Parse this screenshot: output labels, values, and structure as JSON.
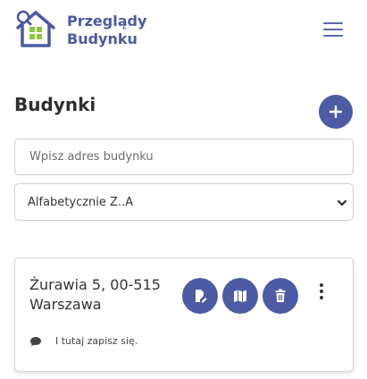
{
  "app": {
    "brand_line1": "Przeglądy",
    "brand_line2": "Budynku",
    "brand_color": "#4a5aa4",
    "logo_roof_color": "#4a5aa4",
    "logo_window_color": "#8cc63f"
  },
  "header": {
    "menu_icon": "hamburger-menu-icon"
  },
  "main": {
    "title": "Budynki",
    "add_icon": "plus-icon",
    "search": {
      "placeholder": "Wpisz adres budynku",
      "value": ""
    },
    "sort": {
      "selected": "Alfabetycznie Z..A"
    }
  },
  "buildings": [
    {
      "address": "Żurawia 5, 00-515 Warszawa",
      "note": "I tutaj zapisz się.",
      "actions": [
        "edit-icon",
        "map-icon",
        "trash-icon"
      ],
      "action_color": "#4d5ba5"
    }
  ]
}
